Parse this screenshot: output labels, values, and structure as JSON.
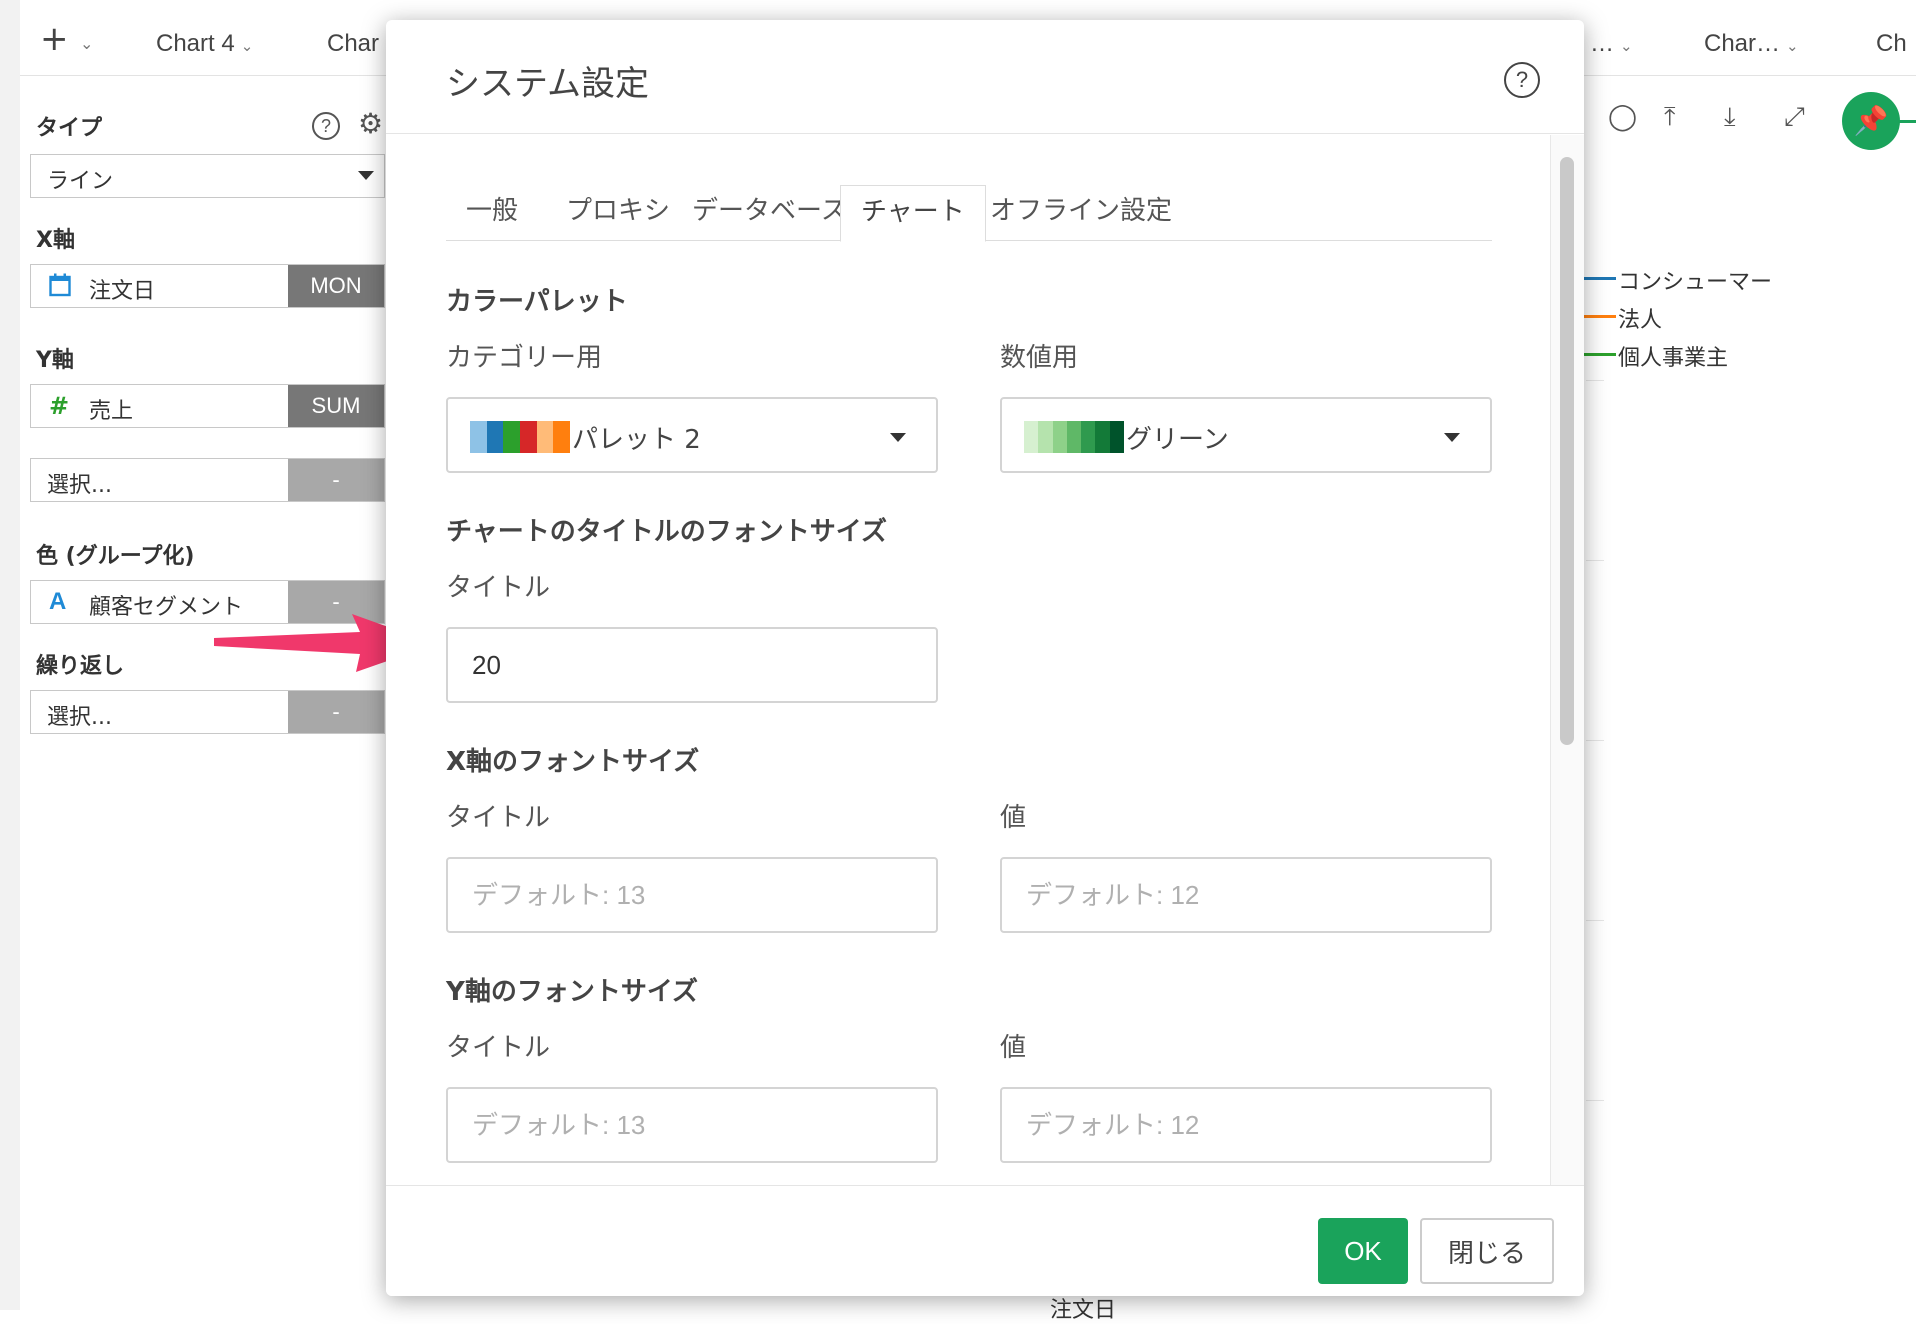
{
  "tabbar": {
    "plus": "+",
    "tabs": [
      {
        "label": "Chart 4"
      },
      {
        "label": "Char"
      },
      {
        "label": "…"
      },
      {
        "label": "Char…"
      },
      {
        "label": "Ch"
      }
    ]
  },
  "panel": {
    "type_label": "タイプ",
    "type_value": "ライン",
    "x_label": "X軸",
    "x_field": "注文日",
    "x_btn": "MON",
    "y_label": "Y軸",
    "y_field": "売上",
    "y_btn": "SUM",
    "y2_field": "選択...",
    "y2_btn": "-",
    "color_label": "色 (グループ化)",
    "color_field": "顧客セグメント",
    "color_btn": "-",
    "repeat_label": "繰り返し",
    "repeat_field": "選択...",
    "repeat_btn": "-"
  },
  "chart": {
    "legend": [
      {
        "name": "コンシューマー",
        "color": "#1f77b4"
      },
      {
        "name": "法人",
        "color": "#ff7f0e"
      },
      {
        "name": "個人事業主",
        "color": "#2ca02c"
      }
    ],
    "x_axis_label": "注文日"
  },
  "modal": {
    "title": "システム設定",
    "help": "?",
    "tabs": [
      {
        "label": "一般"
      },
      {
        "label": "プロキシ"
      },
      {
        "label": "データベース"
      },
      {
        "label": "チャート"
      },
      {
        "label": "オフライン設定"
      }
    ],
    "active_tab": "チャート",
    "palette_heading": "カラーパレット",
    "category_label": "カテゴリー用",
    "category_value": "パレット 2",
    "numeric_label": "数値用",
    "numeric_value": "グリーン",
    "category_swatch": [
      "#8ec2e6",
      "#1f77b4",
      "#2ca02c",
      "#d62728",
      "#ffbb78",
      "#ff7f0e"
    ],
    "numeric_swatch": [
      "#d6f0d0",
      "#b5e3ad",
      "#8ed189",
      "#5fb867",
      "#2f9a4e",
      "#137a38",
      "#00532b"
    ],
    "title_font_heading": "チャートのタイトルのフォントサイズ",
    "title_label": "タイトル",
    "title_value": "20",
    "x_font_heading": "X軸のフォントサイズ",
    "x_title_label": "タイトル",
    "x_title_placeholder": "デフォルト: 13",
    "x_value_label": "値",
    "x_value_placeholder": "デフォルト: 12",
    "y_font_heading": "Y軸のフォントサイズ",
    "y_title_label": "タイトル",
    "y_title_placeholder": "デフォルト: 13",
    "y_value_label": "値",
    "y_value_placeholder": "デフォルト: 12",
    "ok": "OK",
    "close": "閉じる"
  },
  "colors": {
    "accent": "#1aa35b",
    "arrow": "#f0386b"
  }
}
